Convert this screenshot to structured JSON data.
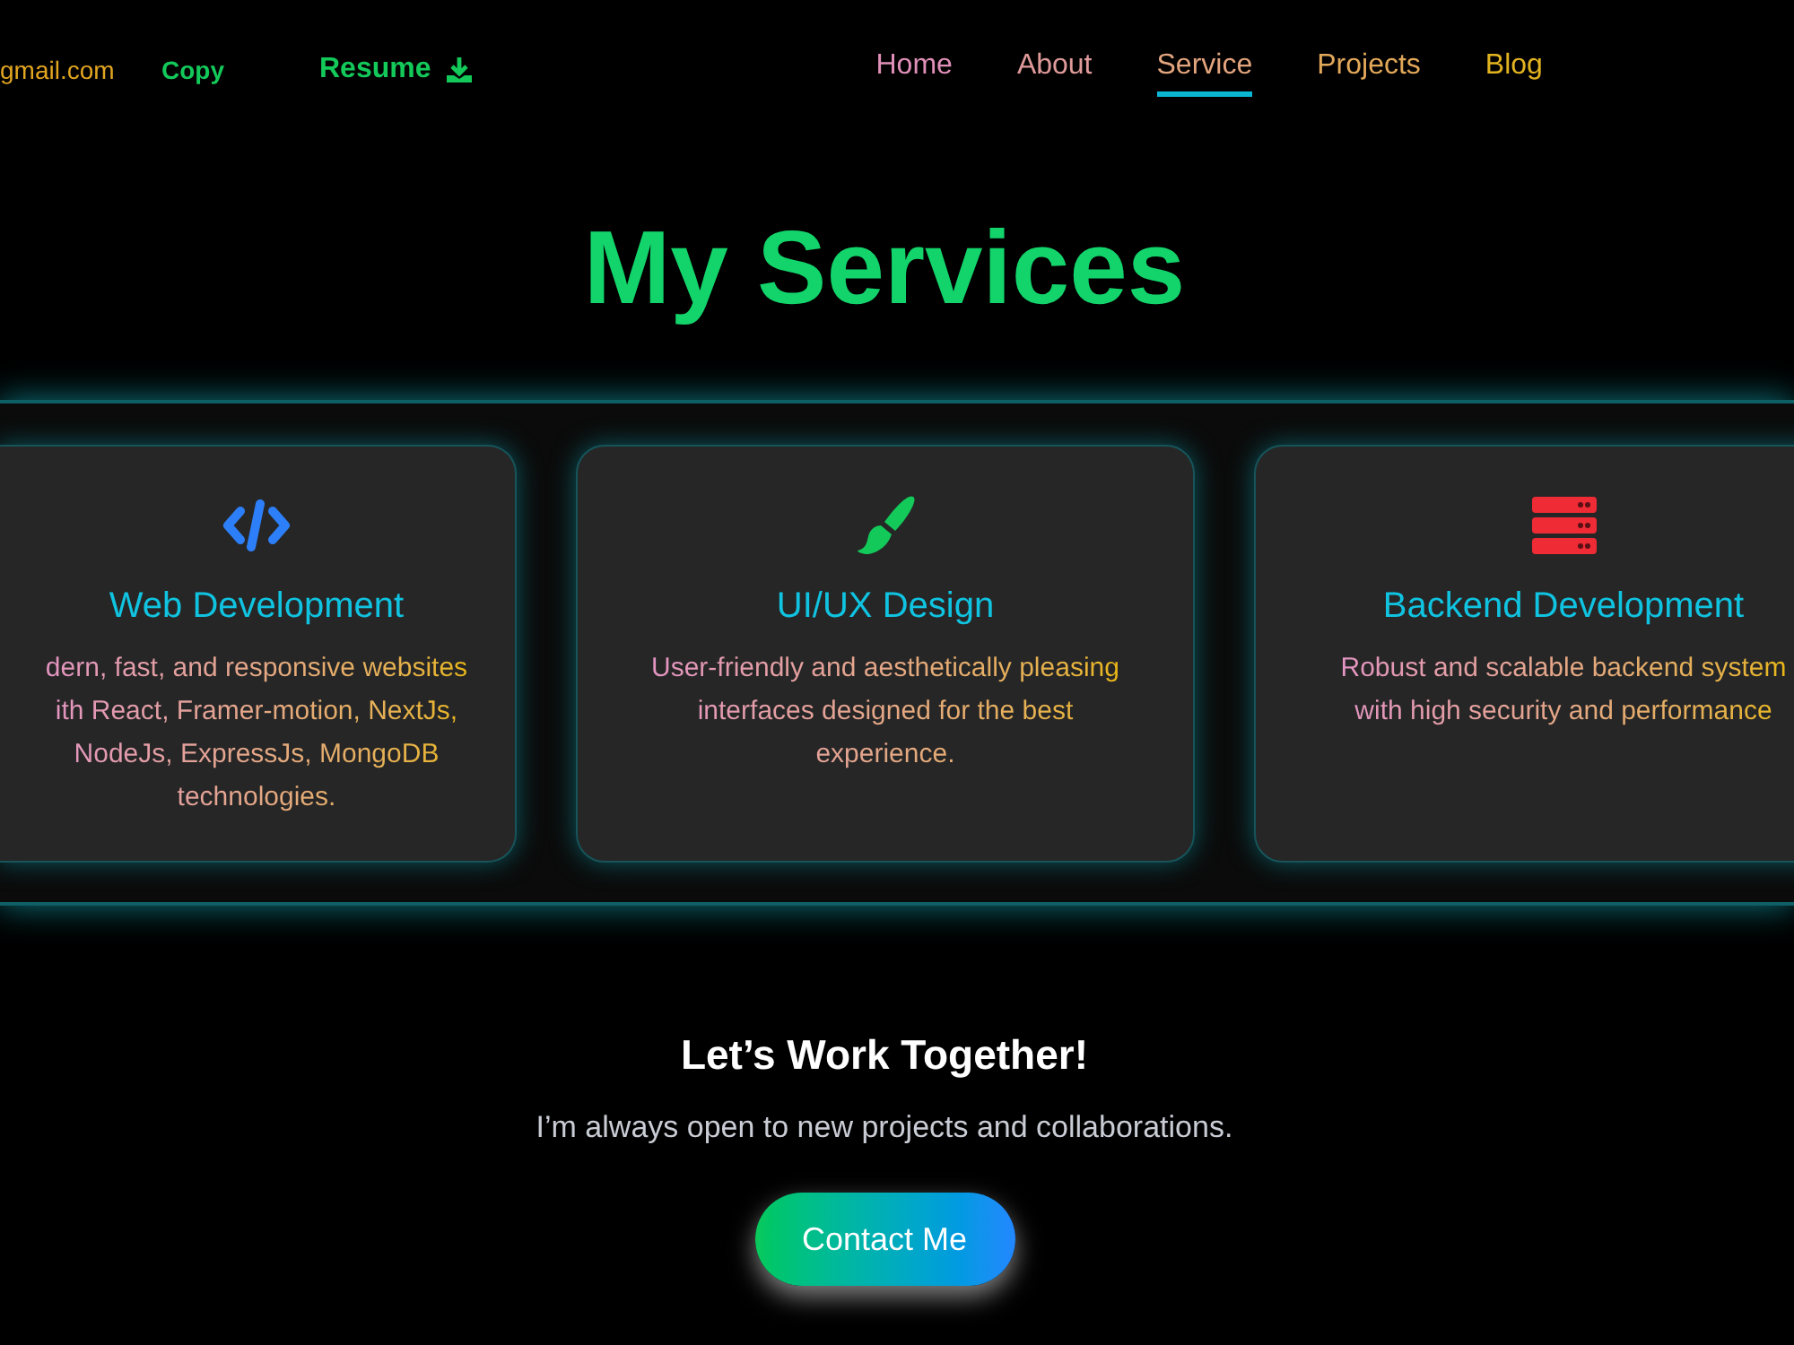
{
  "header": {
    "email": "gmail.com",
    "copy_button": "Copy",
    "resume_link": "Resume"
  },
  "nav": [
    {
      "label": "Home",
      "selected": false
    },
    {
      "label": "About",
      "selected": false
    },
    {
      "label": "Service",
      "selected": true
    },
    {
      "label": "Projects",
      "selected": false
    },
    {
      "label": "Blog",
      "selected": false
    }
  ],
  "title": "My Services",
  "services": [
    {
      "kind": "code",
      "title": "Web Development",
      "lines": [
        "dern, fast, and responsive websites",
        "ith React, Framer-motion, NextJs,",
        "NodeJs, ExpressJs, MongoDB",
        "technologies."
      ]
    },
    {
      "kind": "brush",
      "title": "UI/UX Design",
      "lines": [
        "User-friendly and aesthetically pleasing",
        "interfaces designed for the best",
        "experience."
      ]
    },
    {
      "kind": "server",
      "title": "Backend Development",
      "lines": [
        "Robust and scalable backend system",
        "with high security and performance"
      ]
    }
  ],
  "cta": {
    "heading": "Let’s Work Together!",
    "text": "I’m always open to new projects and collaborations.",
    "button": "Contact Me"
  }
}
